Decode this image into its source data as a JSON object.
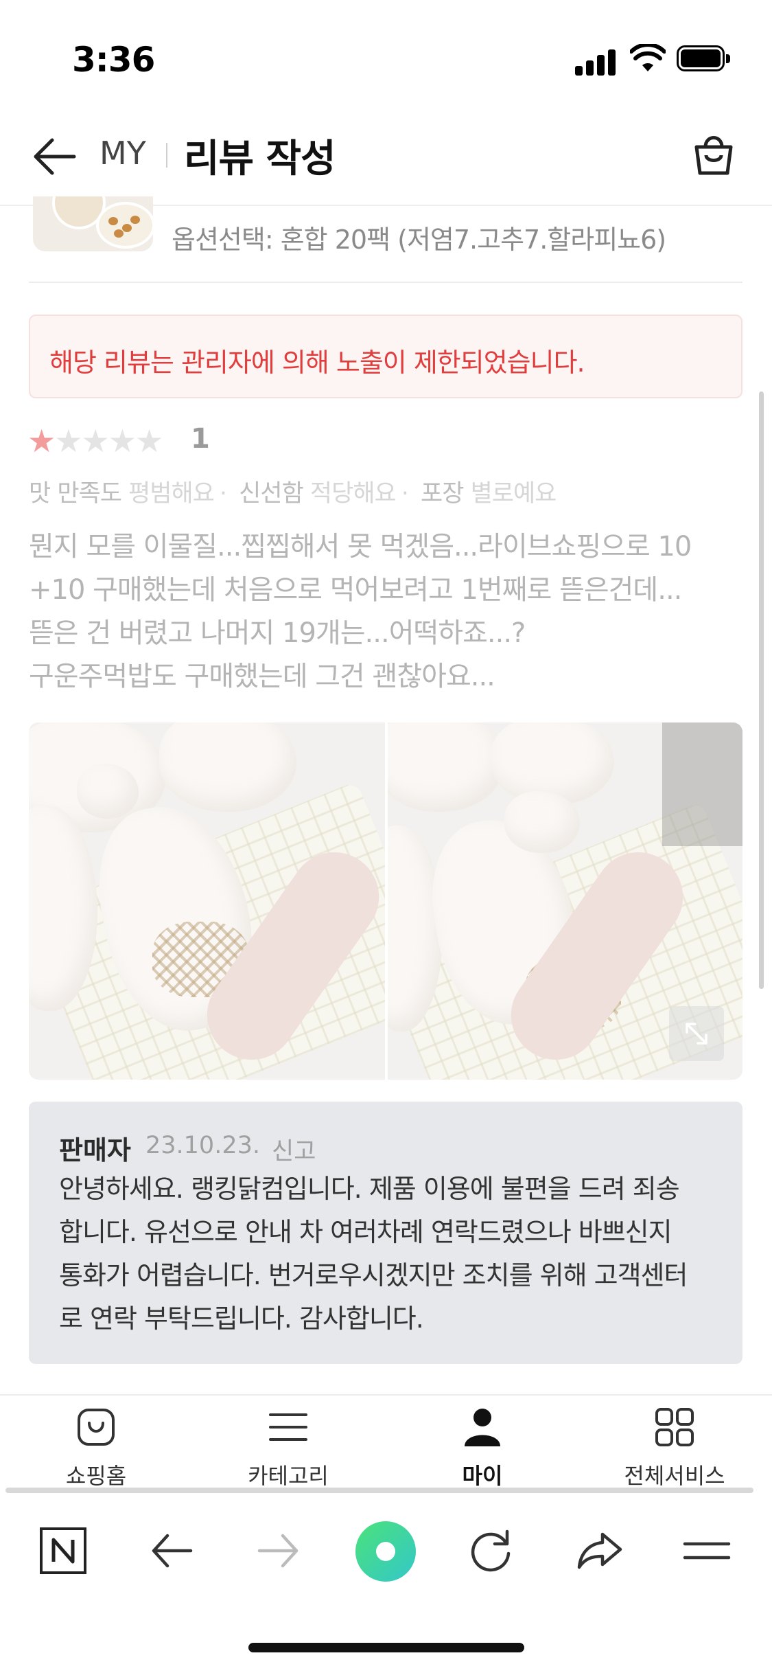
{
  "status_bar": {
    "time": "3:36"
  },
  "header": {
    "section": "MY",
    "title": "리뷰 작성"
  },
  "product": {
    "option": "옵션선택: 혼합 20팩 (저염7.고추7.할라피뇨6)"
  },
  "notice": {
    "text": "해당 리뷰는 관리자에 의해 노출이 제한되었습니다."
  },
  "review": {
    "rating": 1,
    "rating_text": "1",
    "attributes": [
      {
        "key": "맛 만족도",
        "value": "평범해요"
      },
      {
        "key": "신선함",
        "value": "적당해요"
      },
      {
        "key": "포장",
        "value": "별로예요"
      }
    ],
    "body_lines": [
      "뭔지 모를 이물질...찝찝해서 못 먹겠음...라이브쇼핑으로 10",
      "+10 구매했는데 처음으로 먹어보려고 1번째로 뜯은건데...",
      "뜯은 건 버렸고 나머지 19개는...어떡하죠...?",
      "구운주먹밥도 구매했는데 그건 괜찮아요..."
    ]
  },
  "seller_reply": {
    "author": "판매자",
    "date": "23.10.23.",
    "report_label": "신고",
    "body_lines": [
      "안녕하세요. 랭킹닭컴입니다. 제품 이용에 불편을 드려 죄송",
      "합니다. 유선으로 안내 차 여러차례 연락드렸으나 바쁘신지",
      "통화가 어렵습니다. 번거로우시겠지만 조치를 위해 고객센터",
      "로 연락 부탁드립니다. 감사합니다."
    ]
  },
  "tabs": [
    {
      "label": "쇼핑홈",
      "icon": "shopping-bag-icon"
    },
    {
      "label": "카테고리",
      "icon": "menu-icon"
    },
    {
      "label": "마이",
      "icon": "person-icon",
      "active": true
    },
    {
      "label": "전체서비스",
      "icon": "grid-icon"
    }
  ],
  "browser_toolbar": [
    "naver-n-icon",
    "back-arrow-icon",
    "forward-arrow-icon",
    "green-circle-icon",
    "reload-icon",
    "share-icon",
    "menu-icon"
  ],
  "colors": {
    "notice_red": "#e23d3d",
    "star_on": "#f29c9c",
    "green_button": "#3fd18a"
  }
}
